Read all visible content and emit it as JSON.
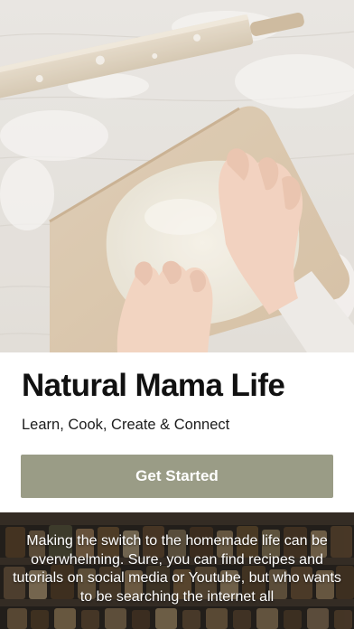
{
  "hero": {
    "image": "kneading-dough-photo"
  },
  "main": {
    "title": "Natural Mama Life",
    "tagline": "Learn, Cook, Create & Connect",
    "cta_label": "Get Started"
  },
  "banner": {
    "image": "pantry-shelves-photo",
    "text": "Making the switch to the homemade life can be overwhelming. Sure, you can find recipes and tutorials on social media or Youtube, but who wants to be searching the internet all"
  },
  "colors": {
    "accent": "#9a9c86",
    "text": "#111111",
    "background": "#ffffff"
  }
}
